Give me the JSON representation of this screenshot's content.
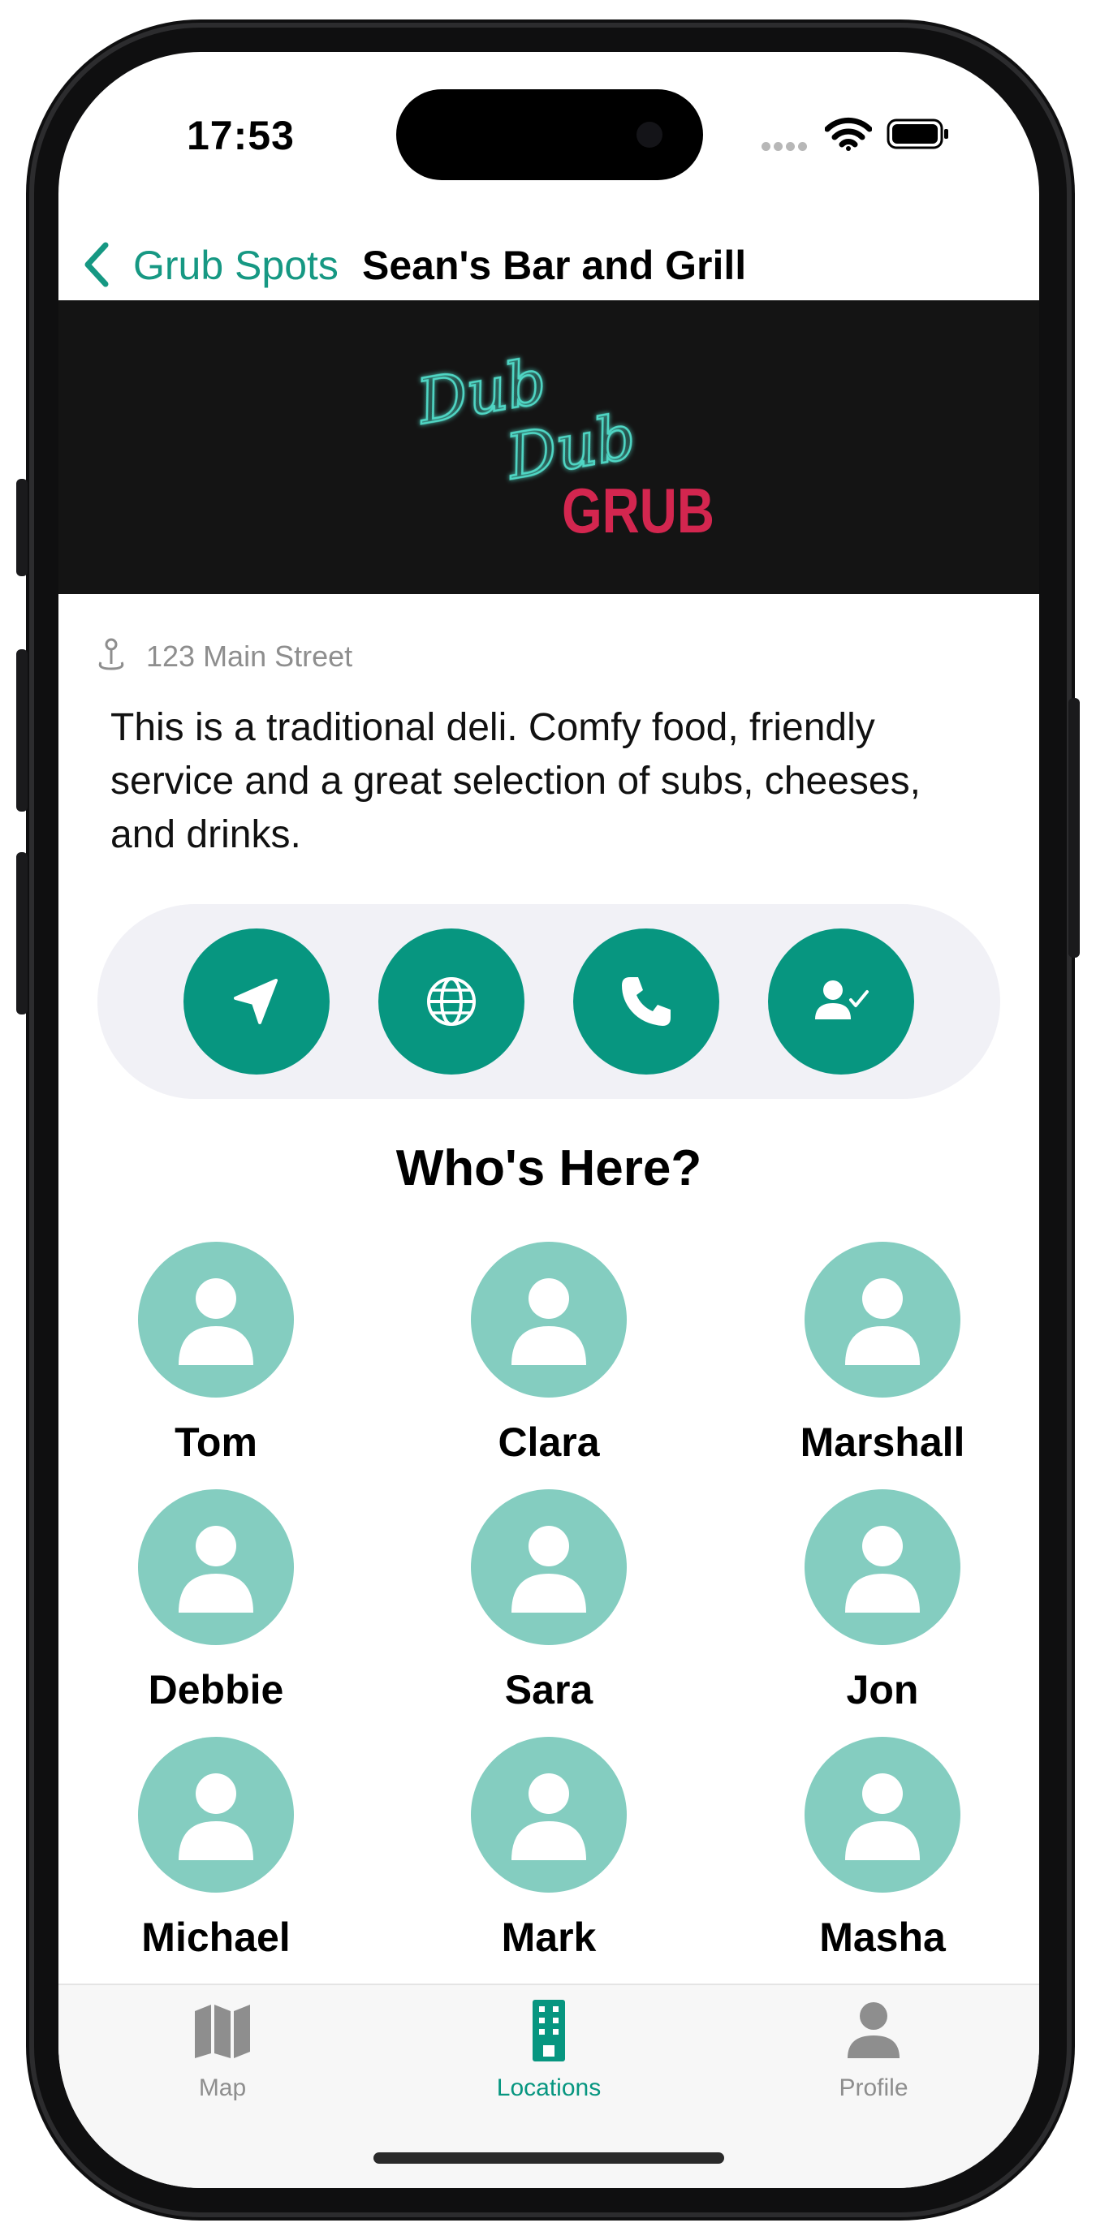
{
  "status_bar": {
    "time": "17:53"
  },
  "nav": {
    "back_label": "Grub Spots",
    "title": "Sean's Bar and Grill"
  },
  "hero": {
    "logo_script_line1": "Dub",
    "logo_script_line2": "Dub",
    "logo_word": "GRUB",
    "colors": {
      "background": "#141414",
      "script": "#4fd6c4",
      "word": "#d3264f"
    }
  },
  "location": {
    "address": "123 Main Street",
    "description": "This is a traditional deli. Comfy food, friendly service and a great selection of subs, cheeses, and drinks."
  },
  "actions": [
    {
      "icon": "location-arrow-icon"
    },
    {
      "icon": "globe-icon"
    },
    {
      "icon": "phone-icon"
    },
    {
      "icon": "check-in-person-icon"
    }
  ],
  "whos_here": {
    "title": "Who's Here?",
    "people": [
      "Tom",
      "Clara",
      "Marshall",
      "Debbie",
      "Sara",
      "Jon",
      "Michael",
      "Mark",
      "Masha"
    ]
  },
  "tab_bar": {
    "tabs": [
      {
        "label": "Map",
        "icon": "map-icon",
        "active": false
      },
      {
        "label": "Locations",
        "icon": "building-icon",
        "active": true
      },
      {
        "label": "Profile",
        "icon": "person-icon",
        "active": false
      }
    ]
  },
  "colors": {
    "accent": "#169883",
    "action_button": "#079680",
    "avatar": "#84cdc0",
    "inactive_tab": "#8e8e8e"
  }
}
